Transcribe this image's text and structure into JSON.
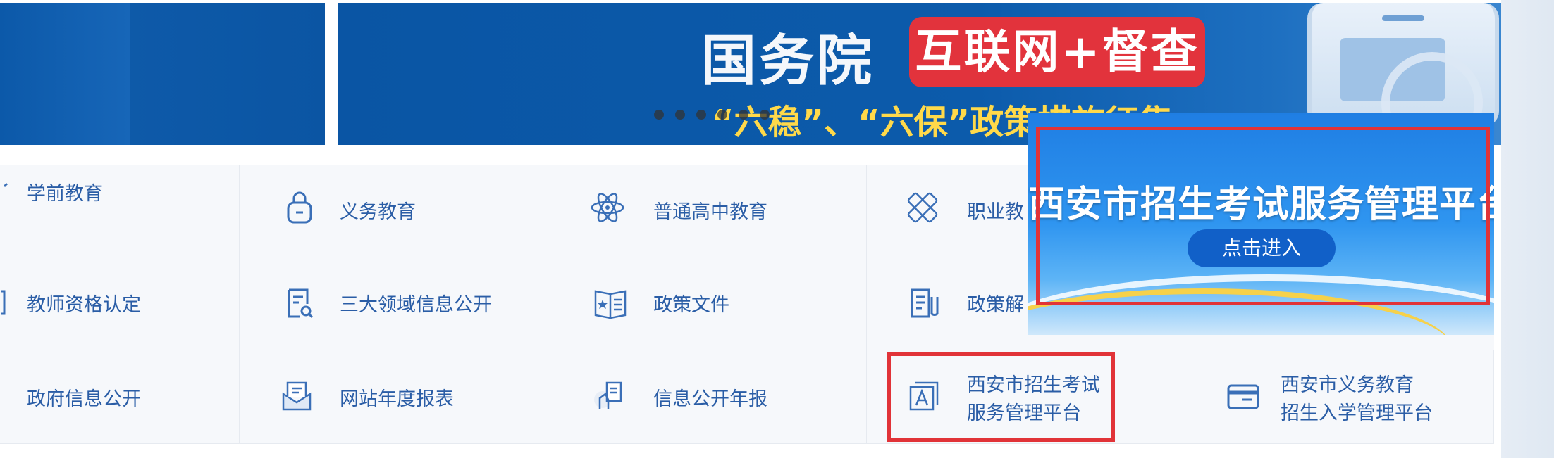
{
  "banner": {
    "title": "国务院",
    "badge": "互联网+督查",
    "subtitle": "“六稳”、“六保”政策措施征集"
  },
  "grid": {
    "row1": [
      {
        "label": "学前教育",
        "icon": "preschool-icon"
      },
      {
        "label": "义务教育",
        "icon": "backpack-icon"
      },
      {
        "label": "普通高中教育",
        "icon": "atom-icon"
      },
      {
        "label": "职业教",
        "icon": "tools-icon"
      }
    ],
    "row2": [
      {
        "label": "教师资格认定",
        "icon": "certificate-icon"
      },
      {
        "label": "三大领域信息公开",
        "icon": "document-search-icon"
      },
      {
        "label": "政策文件",
        "icon": "book-star-icon"
      },
      {
        "label": "政策解",
        "icon": "policy-doc-icon"
      }
    ],
    "row3": [
      {
        "label": "政府信息公开",
        "icon": "info-icon"
      },
      {
        "label": "网站年度报表",
        "icon": "envelope-report-icon"
      },
      {
        "label": "信息公开年报",
        "icon": "hand-doc-icon"
      },
      {
        "label1": "西安市招生考试",
        "label2": "服务管理平台",
        "icon": "exam-platform-icon"
      },
      {
        "label1": "西安市义务教育",
        "label2": "招生入学管理平台",
        "icon": "enrollment-card-icon"
      }
    ]
  },
  "popup": {
    "title": "西安市招生考试服务管理平台",
    "button": "点击进入"
  },
  "colors": {
    "link": "#2a5da6",
    "highlight": "#e13338",
    "banner_blue": "#0a55a4",
    "badge_red": "#e2333c"
  }
}
